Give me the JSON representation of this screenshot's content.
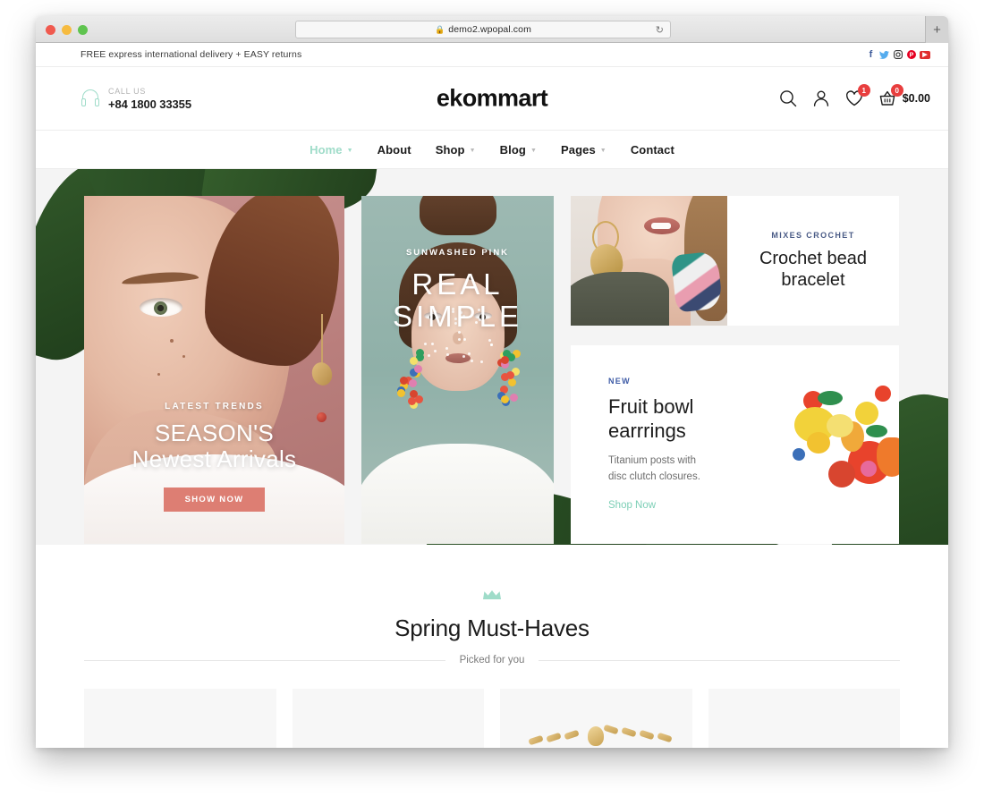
{
  "browser": {
    "url": "demo2.wpopal.com",
    "lock_icon": "lock-icon",
    "reload_icon": "reload-icon",
    "newtab_label": "+"
  },
  "topbar": {
    "message": "FREE express international delivery + EASY returns",
    "socials": [
      {
        "name": "facebook",
        "glyph": "f"
      },
      {
        "name": "twitter",
        "glyph": "✉"
      },
      {
        "name": "instagram",
        "glyph": "□"
      },
      {
        "name": "pinterest",
        "glyph": "P"
      },
      {
        "name": "youtube",
        "glyph": "▶"
      }
    ]
  },
  "header": {
    "call_label": "CALL US",
    "phone": "+84 1800 33355",
    "logo": "ekommart",
    "wishlist_count": "1",
    "cart_count": "0",
    "cart_total": "$0.00"
  },
  "nav": {
    "items": [
      {
        "label": "Home",
        "has_caret": true,
        "active": true
      },
      {
        "label": "About",
        "has_caret": false,
        "active": false
      },
      {
        "label": "Shop",
        "has_caret": true,
        "active": false
      },
      {
        "label": "Blog",
        "has_caret": true,
        "active": false
      },
      {
        "label": "Pages",
        "has_caret": true,
        "active": false
      },
      {
        "label": "Contact",
        "has_caret": false,
        "active": false
      }
    ]
  },
  "hero": {
    "banner1": {
      "eyebrow": "LATEST TRENDS",
      "title_line1": "SEASON'S",
      "title_line2": "Newest Arrivals",
      "button": "SHOW NOW"
    },
    "banner2": {
      "eyebrow": "SUNWASHED PINK",
      "title_line1": "REAL",
      "title_line2": "SIMPLE"
    },
    "crochet_card": {
      "eyebrow": "MIXES CROCHET",
      "title_line1": "Crochet bead",
      "title_line2": "bracelet"
    },
    "fruit_card": {
      "eyebrow": "NEW",
      "title_line1": "Fruit bowl",
      "title_line2": "earrrings",
      "desc_line1": "Titanium posts with",
      "desc_line2": "disc clutch closures.",
      "link": "Shop Now"
    }
  },
  "spring": {
    "crown_icon": "crown-icon",
    "title": "Spring Must-Haves",
    "subtitle": "Picked for you"
  },
  "colors": {
    "accent_mint": "#9fdcc9",
    "accent_teal_link": "#7dcfb6",
    "badge_red": "#e83e3e",
    "button_salmon": "#dd7e73",
    "eyebrow_blue": "#3e5ba6",
    "banner2_bg": "#9db9b2"
  }
}
